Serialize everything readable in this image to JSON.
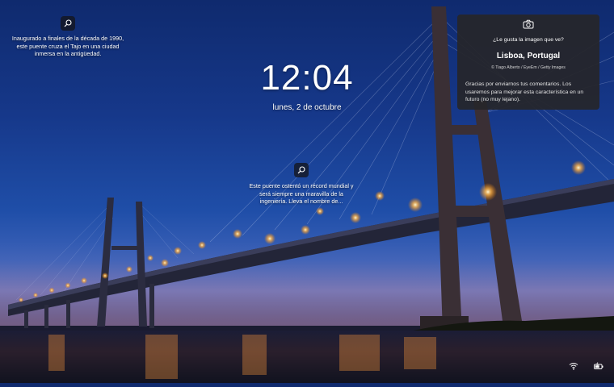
{
  "lockscreen": {
    "time": "12:04",
    "date": "lunes, 2 de octubre"
  },
  "hotspots": [
    {
      "text": "Inaugurado a finales de la década de 1990, este puente cruza el Tajo en una ciudad inmersa en la antigüedad.",
      "icon": "search-icon"
    },
    {
      "text": "Este puente ostentó un récord mundial y será siempre una maravilla de la ingeniería. Lleva el nombre de...",
      "icon": "search-icon"
    }
  ],
  "panel": {
    "question": "¿Le gusta la imagen que ve?",
    "location": "Lisboa, Portugal",
    "credit": "© Tiago Alberto / EyeEm / Getty Images",
    "thanks": "Gracias por enviarnos tus comentarios. Los usaremos para mejorar esta característica en un futuro (no muy lejano).",
    "icon": "camera-icon"
  },
  "system_tray": {
    "icons": [
      "wifi-icon",
      "battery-icon"
    ]
  },
  "colors": {
    "sky_top": "#0f2a6e",
    "panel_bg": "#26262a",
    "light_glow": "#ffb347"
  }
}
